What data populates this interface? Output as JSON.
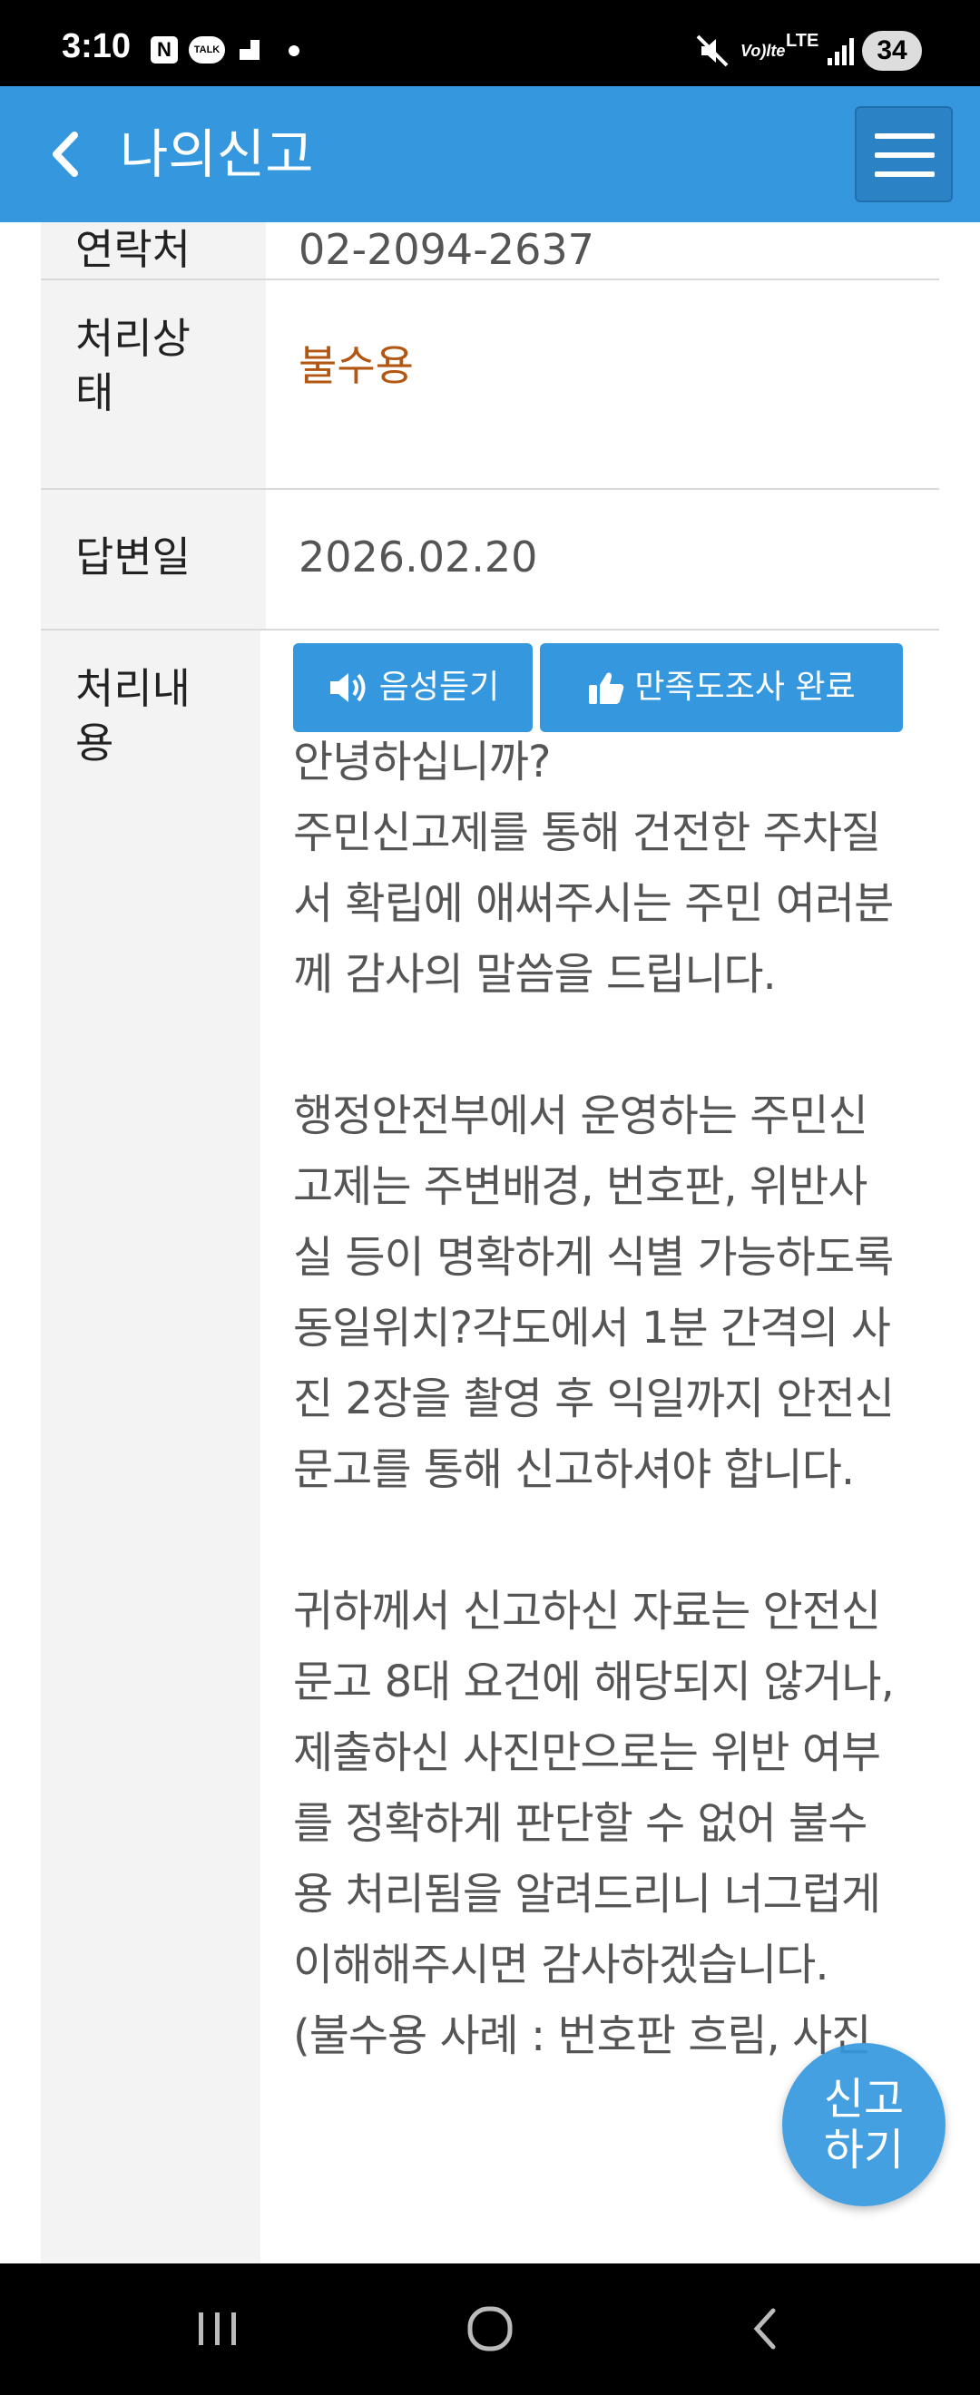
{
  "status_bar": {
    "time": "3:10",
    "icons": [
      "naver-icon",
      "kakaotalk-icon",
      "notification-icon",
      "dot"
    ],
    "right_icons": [
      "mute-icon",
      "volte-icon",
      "lte-icon",
      "signal-icon"
    ],
    "volte": "Vo)lte",
    "lte": "LTE",
    "battery": "34"
  },
  "header": {
    "title": "나의신고",
    "back_icon": "chevron-left-icon",
    "menu_icon": "hamburger-icon",
    "bg_color": "#3598de"
  },
  "rows": {
    "contact": {
      "label": "연락처",
      "value": "02-2094-2637"
    },
    "status": {
      "label": "처리상태",
      "value": "불수용",
      "color": "#b35612"
    },
    "answer_date": {
      "label": "답변일",
      "value": "2026.02.20"
    },
    "content": {
      "label": "처리내용",
      "buttons": {
        "listen": "음성듣기",
        "survey": "만족도조사 완료"
      },
      "text": "안녕하십니까?\n주민신고제를 통해 건전한 주차질서 확립에 애써주시는 주민 여러분께 감사의 말씀을 드립니다.\n\n행정안전부에서 운영하는 주민신고제는 주변배경, 번호판, 위반사실 등이 명확하게 식별 가능하도록 동일위치?각도에서 1분 간격의 사진 2장을 촬영 후 익일까지 안전신문고를 통해 신고하셔야 합니다.\n\n귀하께서 신고하신 자료는 안전신문고 8대 요건에 해당되지 않거나, 제출하신 사진만으로는 위반 여부를 정확하게 판단할 수 없어 불수용 처리됨을 알려드리니 너그럽게 이해해주시면 감사하겠습니다.\n(불수용 사례 : 번호판 흐림, 사진"
    }
  },
  "fab": {
    "line1": "신고",
    "line2": "하기"
  },
  "nav": [
    "recent-apps-icon",
    "home-icon",
    "back-icon"
  ]
}
